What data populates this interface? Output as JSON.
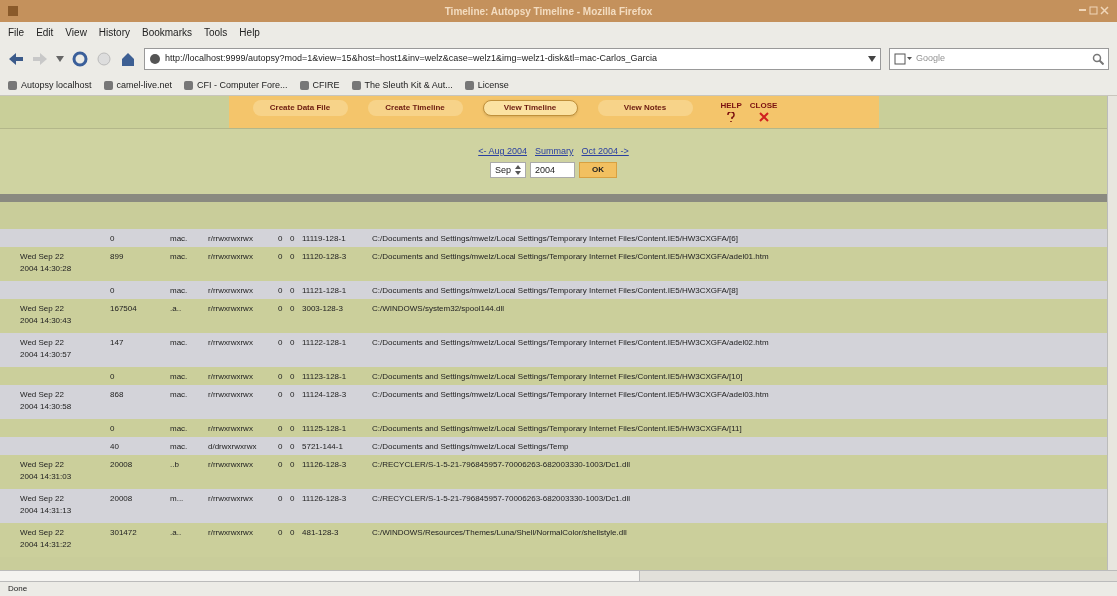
{
  "window": {
    "title": "Timeline: Autopsy Timeline - Mozilla Firefox"
  },
  "menu": [
    "File",
    "Edit",
    "View",
    "History",
    "Bookmarks",
    "Tools",
    "Help"
  ],
  "address_bar": {
    "value": "http://localhost:9999/autopsy?mod=1&view=15&host=host1&inv=welz&case=welz1&img=welz1-disk&tl=mac-Carlos_Garcia"
  },
  "search": {
    "placeholder": "Google"
  },
  "bookmarks": [
    "Autopsy localhost",
    "camel-live.net",
    "CFI - Computer Fore...",
    "CFIRE",
    "The Sleuth Kit & Aut...",
    "License"
  ],
  "toolbar": {
    "buttons": [
      {
        "label": "Create Data File",
        "selected": false
      },
      {
        "label": "Create Timeline",
        "selected": false
      },
      {
        "label": "View Timeline",
        "selected": true
      },
      {
        "label": "View Notes",
        "selected": false
      }
    ],
    "help": "HELP",
    "close": "CLOSE"
  },
  "month_nav": {
    "prev": "<- Aug 2004",
    "summary": "Summary",
    "next": "Oct 2004 ->",
    "month": "Sep",
    "year": "2004",
    "ok": "OK"
  },
  "rows": [
    {
      "date": "",
      "size": "0",
      "flags": "mac.",
      "perm": "r/rrwxrwxrwx",
      "uid": "0",
      "gid": "0",
      "inode": "11119-128-1",
      "path": "C:/Documents and Settings/mwelz/Local Settings/Temporary Internet Files/Content.IE5/HW3CXGFA/[6]"
    },
    {
      "date": "Wed Sep 22 2004 14:30:28",
      "size": "899",
      "flags": "mac.",
      "perm": "r/rrwxrwxrwx",
      "uid": "0",
      "gid": "0",
      "inode": "11120-128-3",
      "path": "C:/Documents and Settings/mwelz/Local Settings/Temporary Internet Files/Content.IE5/HW3CXGFA/adel01.htm"
    },
    {
      "date": "",
      "size": "0",
      "flags": "mac.",
      "perm": "r/rrwxrwxrwx",
      "uid": "0",
      "gid": "0",
      "inode": "11121-128-1",
      "path": "C:/Documents and Settings/mwelz/Local Settings/Temporary Internet Files/Content.IE5/HW3CXGFA/[8]"
    },
    {
      "date": "Wed Sep 22 2004 14:30:43",
      "size": "167504",
      "flags": ".a..",
      "perm": "r/rrwxrwxrwx",
      "uid": "0",
      "gid": "0",
      "inode": "3003-128-3",
      "path": "C:/WINDOWS/system32/spool144.dll"
    },
    {
      "date": "Wed Sep 22 2004 14:30:57",
      "size": "147",
      "flags": "mac.",
      "perm": "r/rrwxrwxrwx",
      "uid": "0",
      "gid": "0",
      "inode": "11122-128-1",
      "path": "C:/Documents and Settings/mwelz/Local Settings/Temporary Internet Files/Content.IE5/HW3CXGFA/adel02.htm"
    },
    {
      "date": "",
      "size": "0",
      "flags": "mac.",
      "perm": "r/rrwxrwxrwx",
      "uid": "0",
      "gid": "0",
      "inode": "11123-128-1",
      "path": "C:/Documents and Settings/mwelz/Local Settings/Temporary Internet Files/Content.IE5/HW3CXGFA/[10]"
    },
    {
      "date": "Wed Sep 22 2004 14:30:58",
      "size": "868",
      "flags": "mac.",
      "perm": "r/rrwxrwxrwx",
      "uid": "0",
      "gid": "0",
      "inode": "11124-128-3",
      "path": "C:/Documents and Settings/mwelz/Local Settings/Temporary Internet Files/Content.IE5/HW3CXGFA/adel03.htm"
    },
    {
      "date": "",
      "size": "0",
      "flags": "mac.",
      "perm": "r/rrwxrwxrwx",
      "uid": "0",
      "gid": "0",
      "inode": "11125-128-1",
      "path": "C:/Documents and Settings/mwelz/Local Settings/Temporary Internet Files/Content.IE5/HW3CXGFA/[11]"
    },
    {
      "date": "",
      "size": "40",
      "flags": "mac.",
      "perm": "d/drwxrwxrwx",
      "uid": "0",
      "gid": "0",
      "inode": "5721-144-1",
      "path": "C:/Documents and Settings/mwelz/Local Settings/Temp"
    },
    {
      "date": "Wed Sep 22 2004 14:31:03",
      "size": "20008",
      "flags": "..b",
      "perm": "r/rrwxrwxrwx",
      "uid": "0",
      "gid": "0",
      "inode": "11126-128-3",
      "path": "C:/RECYCLER/S-1-5-21-796845957-70006263-682003330-1003/Dc1.dll"
    },
    {
      "date": "Wed Sep 22 2004 14:31:13",
      "size": "20008",
      "flags": "m...",
      "perm": "r/rrwxrwxrwx",
      "uid": "0",
      "gid": "0",
      "inode": "11126-128-3",
      "path": "C:/RECYCLER/S-1-5-21-796845957-70006263-682003330-1003/Dc1.dll"
    },
    {
      "date": "Wed Sep 22 2004 14:31:22",
      "size": "301472",
      "flags": ".a..",
      "perm": "r/rrwxrwxrwx",
      "uid": "0",
      "gid": "0",
      "inode": "481-128-3",
      "path": "C:/WINDOWS/Resources/Themes/Luna/Shell/NormalColor/shellstyle.dll"
    }
  ],
  "status_bar": "Done"
}
